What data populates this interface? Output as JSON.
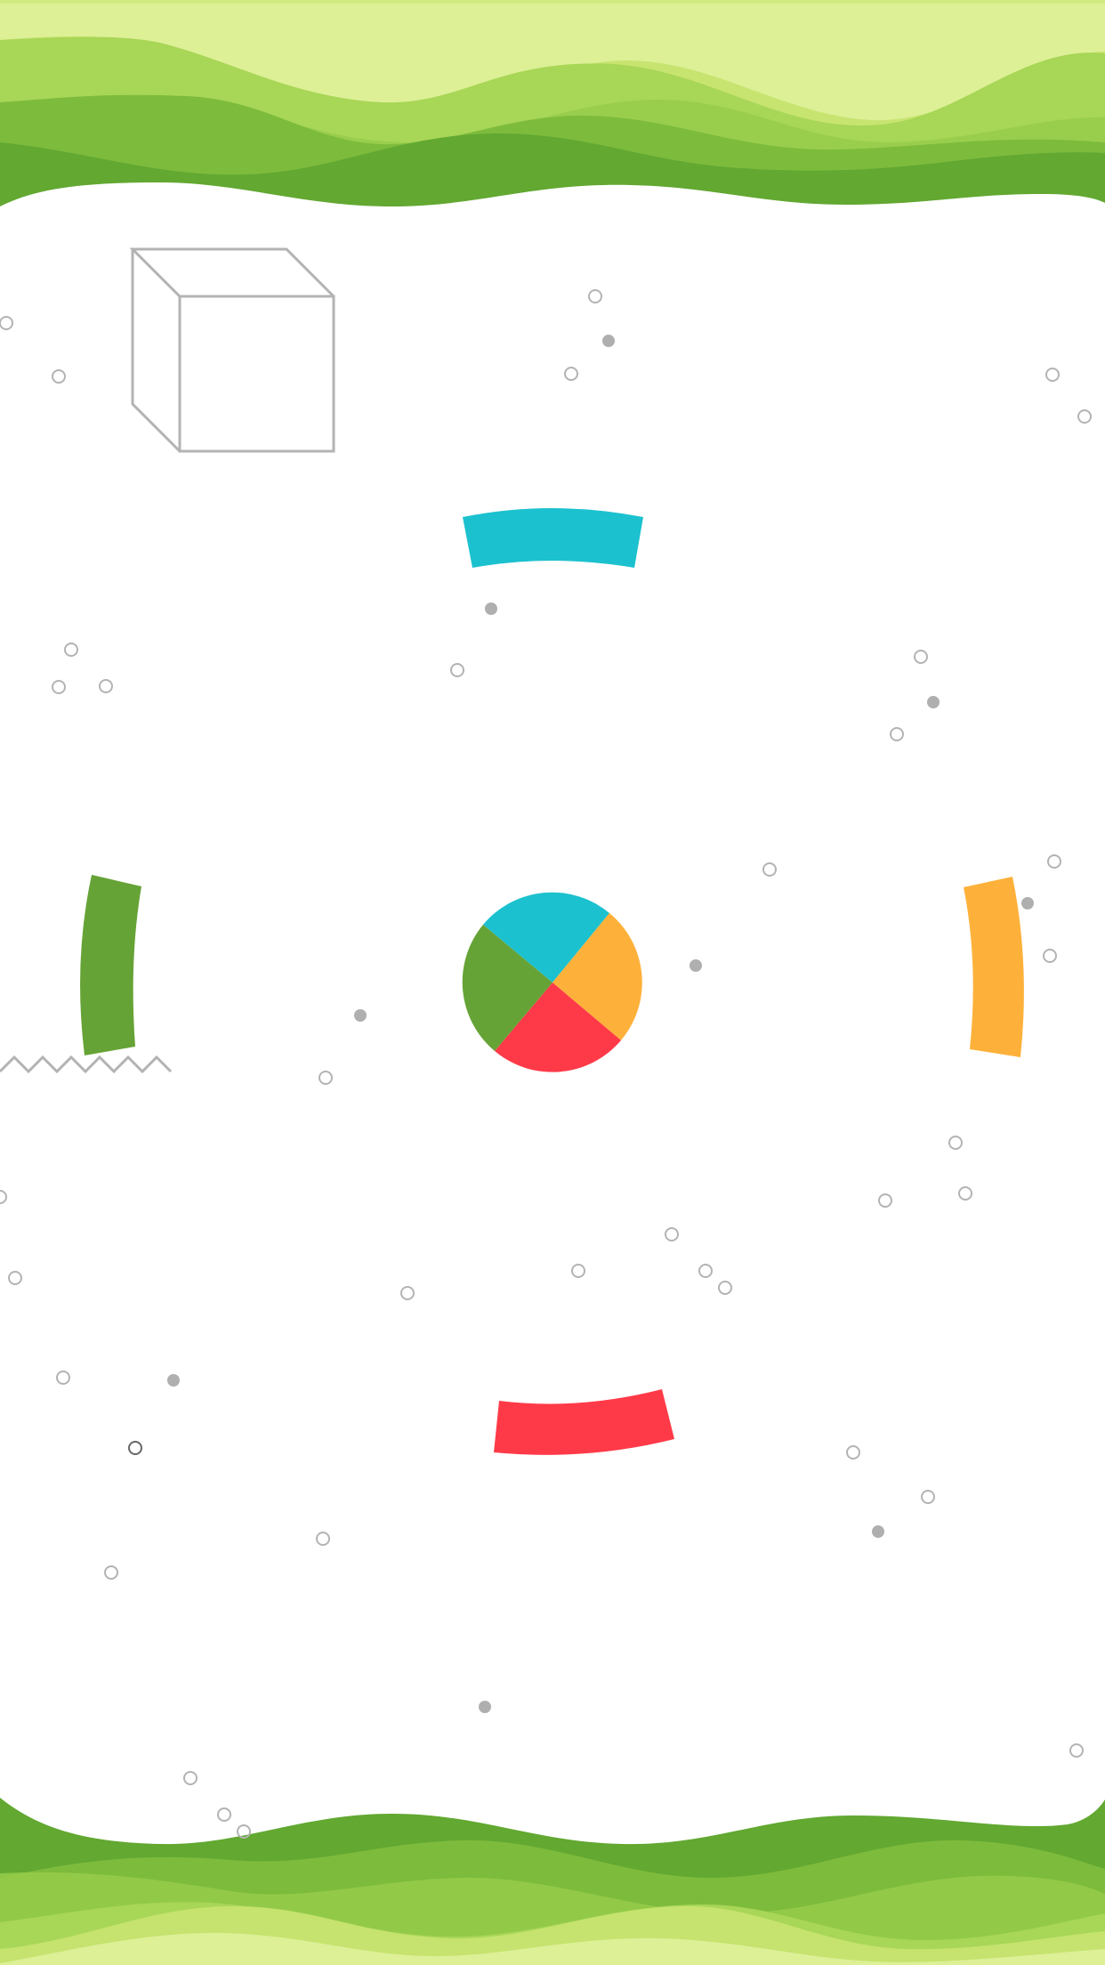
{
  "game": {
    "colors": {
      "cyan": "#1CC1CF",
      "orange": "#FEB13A",
      "red": "#FF3A48",
      "green": "#66A336",
      "decor_gray": "#B3B3B3",
      "wave_darkest": "#62A831",
      "wave_dark": "#7DBB3D",
      "wave_mid": "#A8D656",
      "wave_light": "#C5E36E",
      "wave_lightest": "#DDF096"
    },
    "player_ball": {
      "icon": "four-color-pie-ball",
      "segment_colors": [
        "cyan",
        "orange",
        "red",
        "green"
      ]
    },
    "arc_blocks": [
      {
        "name": "top-arc-block",
        "color": "cyan"
      },
      {
        "name": "right-arc-block",
        "color": "orange"
      },
      {
        "name": "bottom-arc-block",
        "color": "red"
      },
      {
        "name": "left-arc-block",
        "color": "green"
      }
    ],
    "decorations": {
      "cube_icon": "wireframe-cube-outline",
      "zigzag_icon": "zigzag-line",
      "particles": "small-circles-scattered"
    }
  }
}
